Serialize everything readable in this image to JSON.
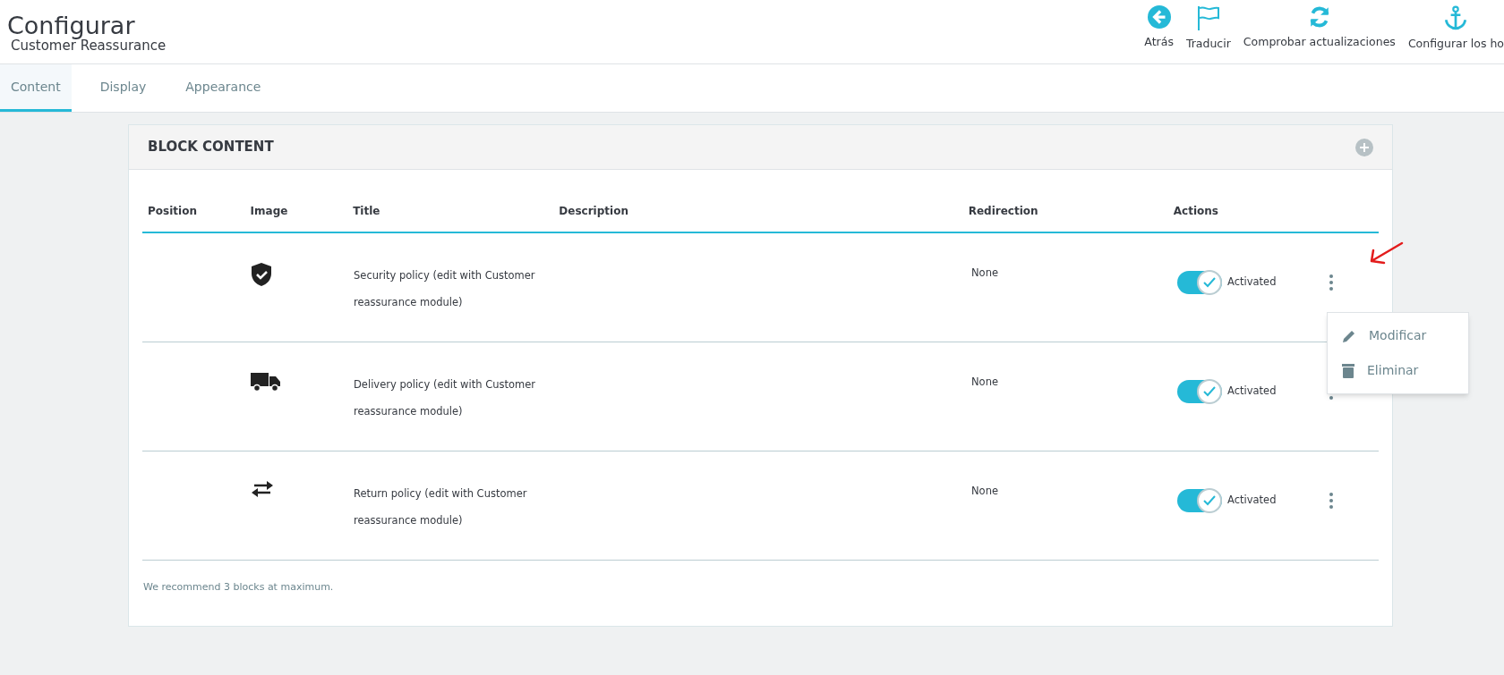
{
  "header": {
    "title": "Configurar",
    "subtitle": "Customer Reassurance"
  },
  "toolbar": [
    {
      "label": "Atrás"
    },
    {
      "label": "Traducir"
    },
    {
      "label": "Comprobar actualizaciones"
    },
    {
      "label": "Configurar los ho"
    }
  ],
  "tabs": [
    {
      "label": "Content",
      "selected": true
    },
    {
      "label": "Display",
      "selected": false
    },
    {
      "label": "Appearance",
      "selected": false
    }
  ],
  "panel": {
    "title": "BLOCK CONTENT",
    "table": {
      "columns": [
        "Position",
        "Image",
        "Title",
        "Description",
        "Redirection",
        "Actions"
      ],
      "rows": [
        {
          "title": "Security policy (edit with Customer reassurance module)",
          "redirection": "None",
          "on": true,
          "status": "Activated",
          "menu_open": true
        },
        {
          "title": "Delivery policy (edit with Customer reassurance module)",
          "redirection": "None",
          "on": true,
          "status": "Activated",
          "menu_open": false
        },
        {
          "title": "Return policy (edit with Customer reassurance module)",
          "redirection": "None",
          "on": true,
          "status": "Activated",
          "menu_open": false
        }
      ]
    },
    "menu": [
      {
        "label": "Modificar"
      },
      {
        "label": "Eliminar"
      }
    ],
    "note": "We recommend 3 blocks at maximum."
  }
}
